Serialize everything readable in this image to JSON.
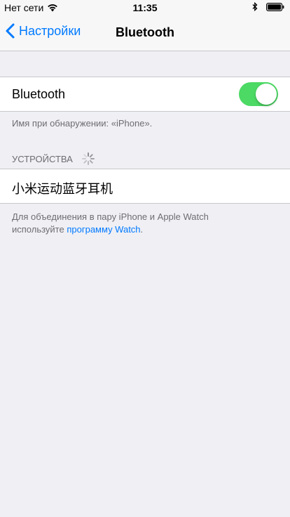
{
  "status_bar": {
    "carrier": "Нет сети",
    "time": "11:35"
  },
  "nav": {
    "back_label": "Настройки",
    "title": "Bluetooth"
  },
  "bluetooth": {
    "label": "Bluetooth",
    "enabled": true,
    "discoverable_text": "Имя при обнаружении: «iPhone»."
  },
  "devices_section": {
    "header": "УСТРОЙСТВА",
    "devices": [
      {
        "name": "小米运动蓝牙耳机"
      }
    ]
  },
  "footer": {
    "line1": "Для объединения в пару iPhone и Apple Watch",
    "line2_prefix": "используйте ",
    "link_text": "программу Watch",
    "line2_suffix": "."
  },
  "colors": {
    "accent": "#007aff",
    "toggle_on": "#4cd964",
    "background": "#efeff4"
  }
}
